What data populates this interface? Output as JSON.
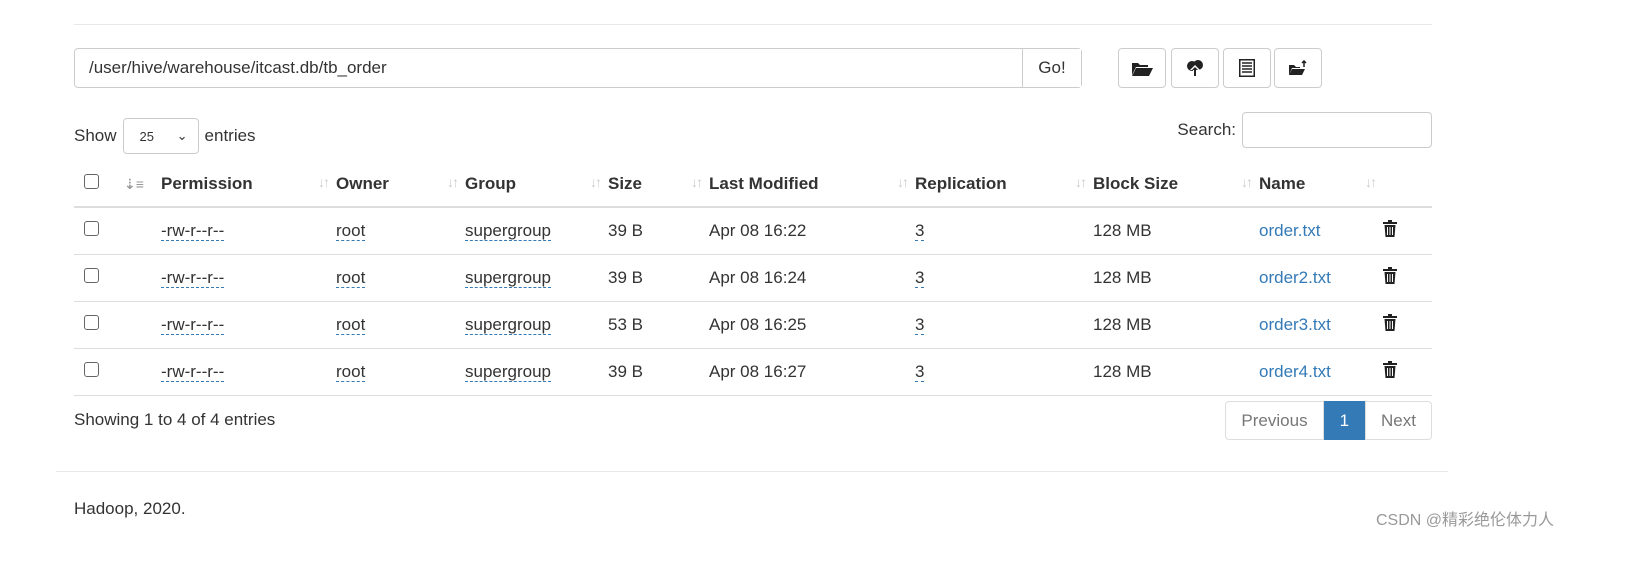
{
  "path": {
    "value": "/user/hive/warehouse/itcast.db/tb_order",
    "go_label": "Go!"
  },
  "toolbar": [
    {
      "icon": "folder-open-icon"
    },
    {
      "icon": "cloud-upload-icon"
    },
    {
      "icon": "list-alt-icon"
    },
    {
      "icon": "folder-move-icon"
    }
  ],
  "length": {
    "show": "Show",
    "value": "25",
    "entries": "entries"
  },
  "search": {
    "label": "Search:",
    "value": ""
  },
  "columns": [
    "Permission",
    "Owner",
    "Group",
    "Size",
    "Last Modified",
    "Replication",
    "Block Size",
    "Name"
  ],
  "rows": [
    {
      "permission": "-rw-r--r--",
      "owner": "root",
      "group": "supergroup",
      "size": "39 B",
      "modified": "Apr 08 16:22",
      "replication": "3",
      "block": "128 MB",
      "name": "order.txt"
    },
    {
      "permission": "-rw-r--r--",
      "owner": "root",
      "group": "supergroup",
      "size": "39 B",
      "modified": "Apr 08 16:24",
      "replication": "3",
      "block": "128 MB",
      "name": "order2.txt"
    },
    {
      "permission": "-rw-r--r--",
      "owner": "root",
      "group": "supergroup",
      "size": "53 B",
      "modified": "Apr 08 16:25",
      "replication": "3",
      "block": "128 MB",
      "name": "order3.txt"
    },
    {
      "permission": "-rw-r--r--",
      "owner": "root",
      "group": "supergroup",
      "size": "39 B",
      "modified": "Apr 08 16:27",
      "replication": "3",
      "block": "128 MB",
      "name": "order4.txt"
    }
  ],
  "info": "Showing 1 to 4 of 4 entries",
  "pagination": {
    "previous": "Previous",
    "current": "1",
    "next": "Next"
  },
  "footer": "Hadoop, 2020.",
  "watermark": "CSDN @精彩绝伦体力人",
  "colors": {
    "link": "#337ab7"
  }
}
